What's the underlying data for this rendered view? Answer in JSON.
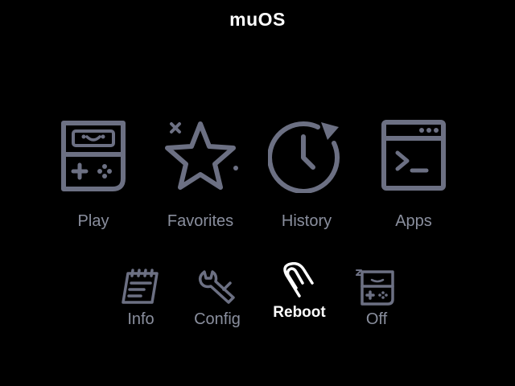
{
  "header": {
    "title": "muOS"
  },
  "main_menu": [
    {
      "label": "Play",
      "icon": "gameboy-icon"
    },
    {
      "label": "Favorites",
      "icon": "star-icon"
    },
    {
      "label": "History",
      "icon": "clock-history-icon"
    },
    {
      "label": "Apps",
      "icon": "terminal-window-icon"
    }
  ],
  "sub_menu": [
    {
      "label": "Info",
      "icon": "notepad-icon"
    },
    {
      "label": "Config",
      "icon": "wrench-icon"
    },
    {
      "label": "Reboot",
      "icon": "paperclip-icon",
      "selected": true
    },
    {
      "label": "Off",
      "icon": "sleeping-gameboy-icon"
    }
  ],
  "colors": {
    "background": "#000000",
    "icon": "#6c7083",
    "label": "#8a8f9e",
    "selected": "#ffffff"
  }
}
